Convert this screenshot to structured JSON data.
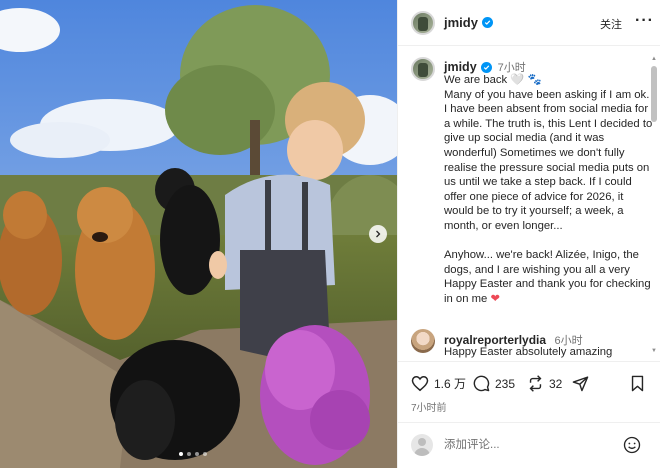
{
  "post": {
    "username": "jmidy",
    "follow_label": "关注",
    "more_label": "···",
    "carousel_dots": 4
  },
  "caption": {
    "username": "jmidy",
    "time": "7小时",
    "line1": "We are back 🤍 🐾",
    "para1": "Many of you have been asking if I am ok. I have been absent from social media for a while. The truth is, this Lent I decided to give up social media (and it was wonderful) Sometimes we don't fully realise the pressure social media puts on us until we take a step back. If I could offer one piece of advice for 2026, it would be to try it yourself; a week, a month, or even longer...",
    "para2": "Anyhow... we're back! Alizée, Inigo, the dogs, and I are wishing you all a very Happy Easter and thank you for checking in on me",
    "para2_emoji": "❤"
  },
  "reply": {
    "username": "royalreporterlydia",
    "time": "6小时",
    "text": "Happy Easter absolutely amazing photos. Giving up social media"
  },
  "actions": {
    "likes": "1.6 万",
    "comments": "235",
    "reposts": "32",
    "timestamp": "7小时前"
  },
  "comment_box": {
    "placeholder": "添加评论..."
  },
  "icons": {
    "like": "heart-icon",
    "comment": "comment-bubble-icon",
    "repost": "repost-icon",
    "share": "paper-plane-icon",
    "save": "bookmark-icon",
    "emoji": "emoji-icon",
    "next": "chevron-right-icon"
  },
  "colors": {
    "verified": "#0095f6",
    "heart": "#ed4956",
    "secondary_text": "#737373"
  }
}
